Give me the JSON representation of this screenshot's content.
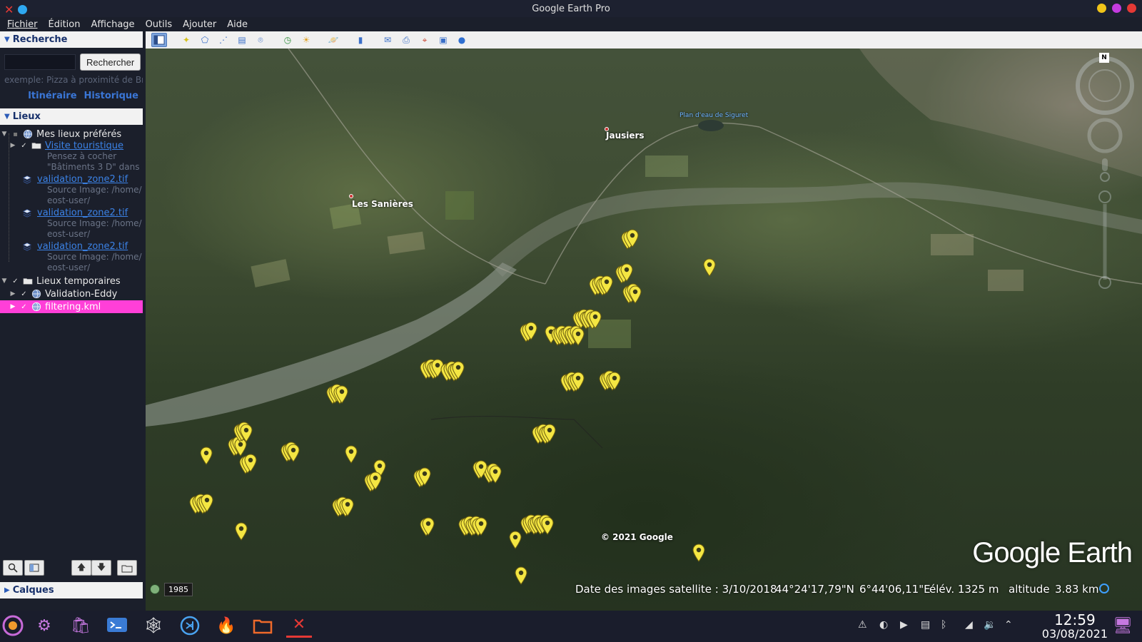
{
  "window": {
    "title": "Google Earth Pro"
  },
  "menu": [
    "Fichier",
    "Édition",
    "Affichage",
    "Outils",
    "Ajouter",
    "Aide"
  ],
  "search": {
    "header": "Recherche",
    "button": "Rechercher",
    "hint": "exemple: Pizza à proximité de Bre",
    "link_itinerary": "Itinéraire",
    "link_history": "Historique"
  },
  "places": {
    "header": "Lieux",
    "my_places": "Mes lieux préférés",
    "tour": "Visite touristique",
    "tour_sub1": "Pensez à cocher",
    "tour_sub2": "\"Bâtiments 3 D\" dans",
    "overlays": [
      {
        "label": "validation_zone2.tif",
        "sub1": "Source Image: /home/",
        "sub2": "eost-user/"
      },
      {
        "label": "validation_zone2.tif",
        "sub1": "Source Image: /home/",
        "sub2": "eost-user/"
      },
      {
        "label": "validation_zone2.tif",
        "sub1": "Source Image: /home/",
        "sub2": "eost-user/"
      }
    ],
    "temp_places": "Lieux temporaires",
    "validation": "Validation-Eddy",
    "filtering": "filtering.kml"
  },
  "layers": {
    "header": "Calques"
  },
  "map": {
    "labels": {
      "jausiers": "Jausiers",
      "sanieres": "Les Sanières",
      "lake": "Plan d'eau de Siguret"
    },
    "copyright": "© 2021 Google",
    "logo": "Google Earth",
    "year": "1985",
    "status": {
      "date": "Date des images satellite : 3/10/2018",
      "lat": "44°24'17,79\"N",
      "lon": "6°44'06,11\"E",
      "elev": "élév. 1325 m",
      "alt_label": "altitude",
      "alt_value": "3.83 km"
    },
    "compass": "N"
  },
  "taskbar": {
    "time": "12:59",
    "date": "03/08/2021"
  },
  "colors": {
    "accent_highlight": "#ff3fd8",
    "pin_yellow": "#f4e642",
    "link_blue": "#3b82e6"
  }
}
